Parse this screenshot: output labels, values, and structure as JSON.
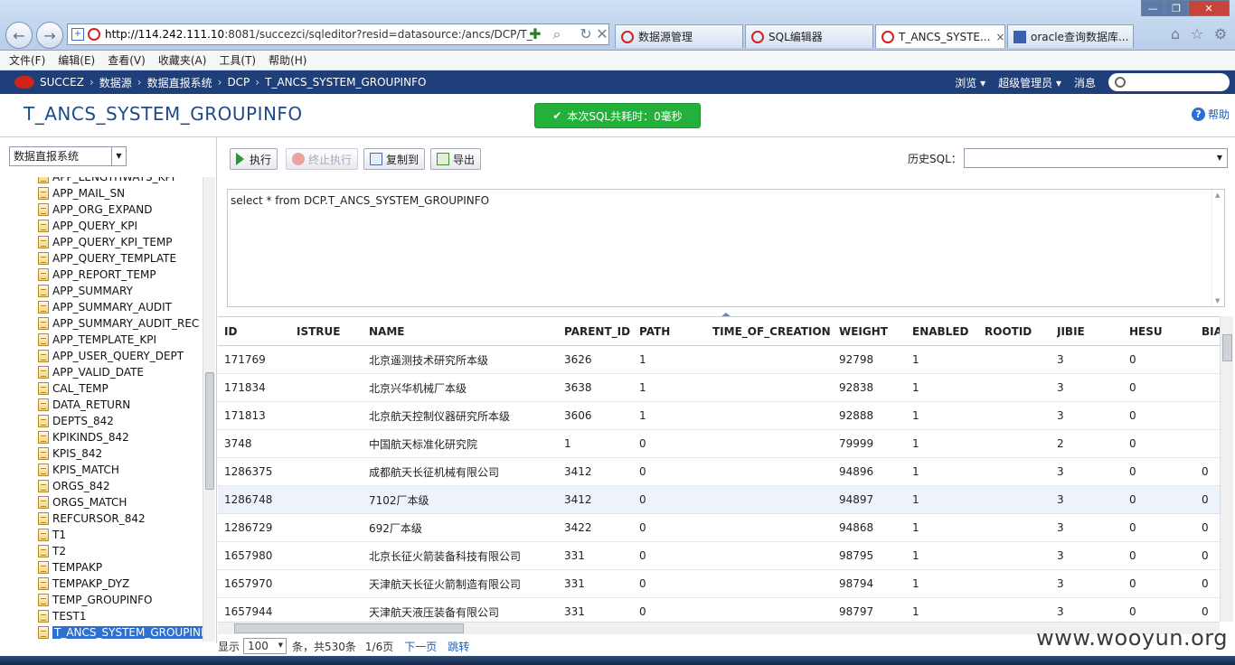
{
  "browser": {
    "url_host": "http://114.242.111.10",
    "url_rest": ":8081/succezci/sqleditor?resid=datasource:/ancs/DCP/T_",
    "tabs": [
      {
        "label": "数据源管理",
        "active": false
      },
      {
        "label": "SQL编辑器",
        "active": false
      },
      {
        "label": "T_ANCS_SYSTE...",
        "active": true
      },
      {
        "label": "oracle查询数据库...",
        "active": false
      }
    ],
    "tab_close": "×"
  },
  "menu": [
    "文件(F)",
    "编辑(E)",
    "查看(V)",
    "收藏夹(A)",
    "工具(T)",
    "帮助(H)"
  ],
  "app_header": {
    "brand": "SUCCEZ",
    "breadcrumb": [
      "数据源",
      "数据直报系统",
      "DCP",
      "T_ANCS_SYSTEM_GROUPINFO"
    ],
    "sep": "›",
    "right": [
      "浏览 ▾",
      "超级管理员 ▾",
      "消息"
    ]
  },
  "page": {
    "title": "T_ANCS_SYSTEM_GROUPINFO",
    "toast": "本次SQL共耗时：0毫秒",
    "help": "帮助"
  },
  "left": {
    "db_select": "数据直报系统",
    "tree": [
      "APP_LENGTHWAYS_KPI",
      "APP_MAIL_SN",
      "APP_ORG_EXPAND",
      "APP_QUERY_KPI",
      "APP_QUERY_KPI_TEMP",
      "APP_QUERY_TEMPLATE",
      "APP_REPORT_TEMP",
      "APP_SUMMARY",
      "APP_SUMMARY_AUDIT",
      "APP_SUMMARY_AUDIT_REC",
      "APP_TEMPLATE_KPI",
      "APP_USER_QUERY_DEPT",
      "APP_VALID_DATE",
      "CAL_TEMP",
      "DATA_RETURN",
      "DEPTS_842",
      "KPIKINDS_842",
      "KPIS_842",
      "KPIS_MATCH",
      "ORGS_842",
      "ORGS_MATCH",
      "REFCURSOR_842",
      "T1",
      "T2",
      "TEMPAKP",
      "TEMPAKP_DYZ",
      "TEMP_GROUPINFO",
      "TEST1",
      "T_ANCS_SYSTEM_GROUPINFO"
    ],
    "selected_index": 28
  },
  "toolbar": {
    "execute": "执行",
    "stop": "终止执行",
    "copy": "复制到",
    "export": "导出",
    "history_label": "历史SQL："
  },
  "sql": "select * from DCP.T_ANCS_SYSTEM_GROUPINFO",
  "grid": {
    "columns": [
      "ID",
      "ISTRUE",
      "NAME",
      "PARENT_ID",
      "PATH",
      "TIME_OF_CREATION",
      "WEIGHT",
      "ENABLED",
      "ROOTID",
      "JIBIE",
      "HESU",
      "BIA"
    ],
    "rows": [
      [
        "171769",
        "",
        "北京遥测技术研究所本级",
        "3626",
        "1",
        "",
        "92798",
        "1",
        "",
        "3",
        "0",
        ""
      ],
      [
        "171834",
        "",
        "北京兴华机械厂本级",
        "3638",
        "1",
        "",
        "92838",
        "1",
        "",
        "3",
        "0",
        ""
      ],
      [
        "171813",
        "",
        "北京航天控制仪器研究所本级",
        "3606",
        "1",
        "",
        "92888",
        "1",
        "",
        "3",
        "0",
        ""
      ],
      [
        "3748",
        "",
        "中国航天标准化研究院",
        "1",
        "0",
        "",
        "79999",
        "1",
        "",
        "2",
        "0",
        ""
      ],
      [
        "1286375",
        "",
        "成都航天长征机械有限公司",
        "3412",
        "0",
        "",
        "94896",
        "1",
        "",
        "3",
        "0",
        "0"
      ],
      [
        "1286748",
        "",
        "7102厂本级",
        "3412",
        "0",
        "",
        "94897",
        "1",
        "",
        "3",
        "0",
        "0"
      ],
      [
        "1286729",
        "",
        "692厂本级",
        "3422",
        "0",
        "",
        "94868",
        "1",
        "",
        "3",
        "0",
        "0"
      ],
      [
        "1657980",
        "",
        "北京长征火箭装备科技有限公司",
        "331",
        "0",
        "",
        "98795",
        "1",
        "",
        "3",
        "0",
        "0"
      ],
      [
        "1657970",
        "",
        "天津航天长征火箭制造有限公司",
        "331",
        "0",
        "",
        "98794",
        "1",
        "",
        "3",
        "0",
        "0"
      ],
      [
        "1657944",
        "",
        "天津航天液压装备有限公司",
        "331",
        "0",
        "",
        "98797",
        "1",
        "",
        "3",
        "0",
        "0"
      ]
    ],
    "highlight_row": 5
  },
  "pager": {
    "show": "显示",
    "page_size": "100",
    "summary": "条，共530条",
    "page": "1/6页",
    "next": "下一页",
    "jump": "跳转"
  },
  "watermark": "www.wooyun.org",
  "colors": {
    "header_bg": "#1f3f7a",
    "toast_bg": "#24b13b",
    "title": "#1f4a8a",
    "link": "#1f5fb5"
  }
}
